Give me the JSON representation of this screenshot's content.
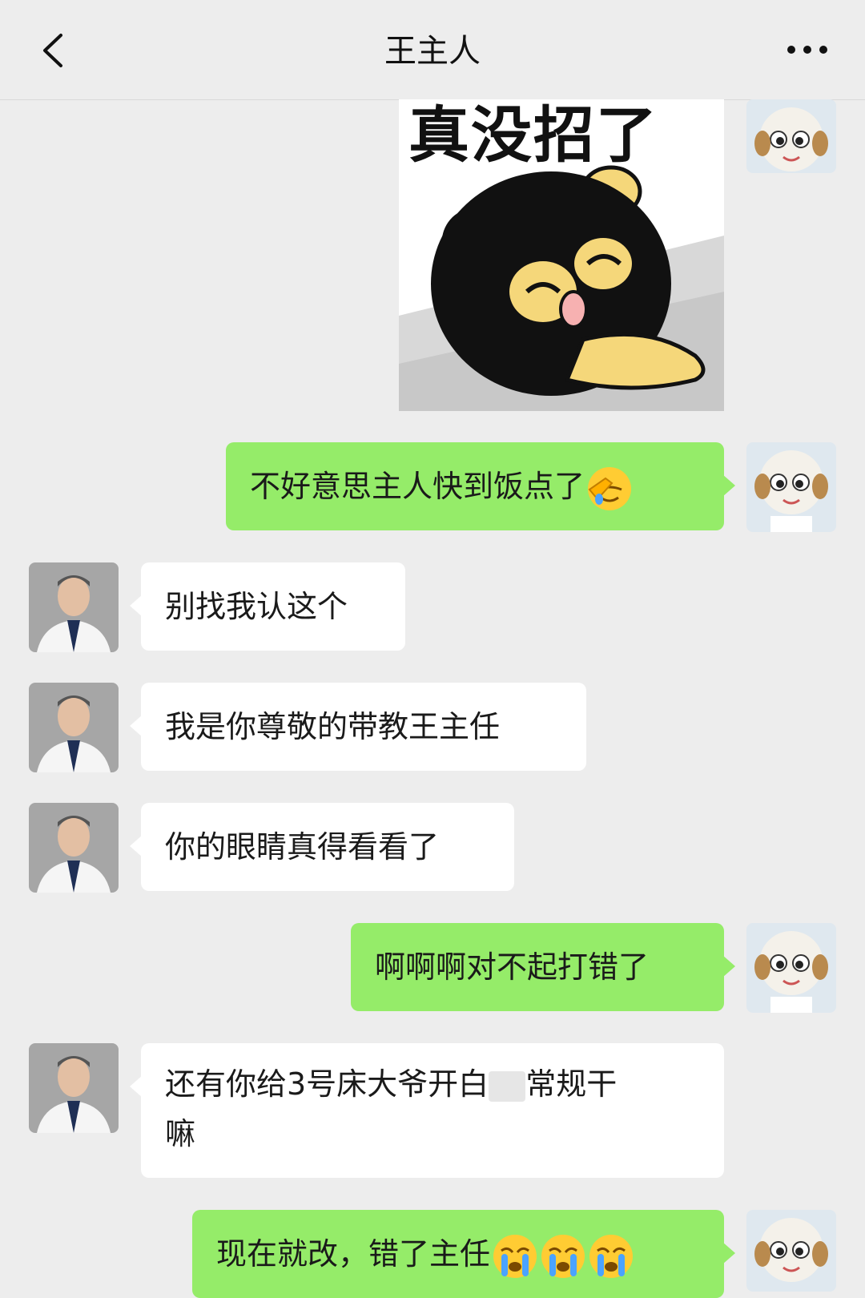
{
  "header": {
    "title": "王主人",
    "back_icon": "chevron-left-icon",
    "more_icon": "more-dots-icon"
  },
  "messages": [
    {
      "sender": "me",
      "type": "sticker",
      "text": "真没招了"
    },
    {
      "sender": "me",
      "type": "text",
      "text": "不好意思主人快到饭点了",
      "emoji": "facepalm-emoji"
    },
    {
      "sender": "other",
      "type": "text",
      "text": "别找我认这个"
    },
    {
      "sender": "other",
      "type": "text",
      "text": "我是你尊敬的带教王主任"
    },
    {
      "sender": "other",
      "type": "text",
      "text": "你的眼睛真得看看了"
    },
    {
      "sender": "me",
      "type": "text",
      "text": "啊啊啊对不起打错了"
    },
    {
      "sender": "other",
      "type": "text",
      "text_line1": "还有你给3号床大爷开白",
      "text_line1b": "常规干",
      "text_line2": "嘛"
    },
    {
      "sender": "me",
      "type": "text",
      "text": "现在就改，错了主任",
      "emoji": "crying-emoji"
    }
  ],
  "colors": {
    "background": "#ededed",
    "my_bubble": "#95ec69",
    "other_bubble": "#ffffff"
  }
}
